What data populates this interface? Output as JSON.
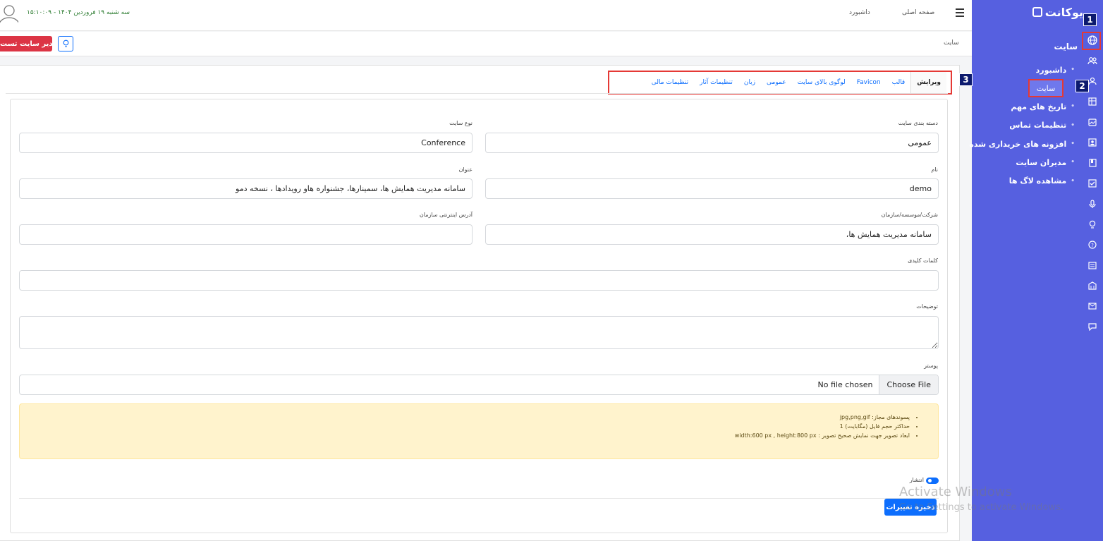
{
  "brand": {
    "name": "یوکانت"
  },
  "header": {
    "datetime": "سه شنبه ۱۹ فروردین ۱۴۰۴ - ۱۵:۱۰:۰۹",
    "links": {
      "dashboard": "داشبورد",
      "home": "صفحه اصلی"
    }
  },
  "toolbar": {
    "admin_button": "مدیر سایت تست",
    "breadcrumb": "سایت"
  },
  "sidebar": {
    "section_title": "سایت",
    "items": [
      {
        "label": "داشبورد"
      },
      {
        "label": "سایت"
      },
      {
        "label": "تاریخ های مهم"
      },
      {
        "label": "تنظیمات تماس"
      },
      {
        "label": "افزونه های خریداری شده"
      },
      {
        "label": "مدیران سایت"
      },
      {
        "label": "مشاهده لاگ ها"
      }
    ]
  },
  "tabs": [
    "ویرایش",
    "قالب",
    "Favicon",
    "لوگوی بالای سایت",
    "عمومی",
    "زبان",
    "تنظیمات آثار",
    "تنظیمات مالی"
  ],
  "form": {
    "site_category": {
      "label": "دسته بندی سایت",
      "value": "عمومی"
    },
    "site_type": {
      "label": "نوع سایت",
      "value": "Conference"
    },
    "name": {
      "label": "نام",
      "value": "demo"
    },
    "title": {
      "label": "عنوان",
      "value": "سامانه مدیریت همایش ها، سمینارها، جشنواره هاو رویدادها ، نسخه دمو"
    },
    "company": {
      "label": "شرکت/موسسه/سازمان",
      "value": "سامانه مدیریت همایش ها،"
    },
    "website": {
      "label": "آدرس اینترنتی سازمان",
      "value": ""
    },
    "keywords": {
      "label": "کلمات کلیدی",
      "value": ""
    },
    "description": {
      "label": "توضیحات",
      "value": ""
    },
    "poster": {
      "label": "پوستر",
      "button": "Choose File",
      "status": "No file chosen"
    },
    "notice": [
      "پسوندهای مجاز: jpg,png,gif",
      "حداکثر حجم فایل (مگابایت) 1",
      "ابعاد تصویر جهت نمایش صحیح تصویر : width:600 px , height:800 px"
    ],
    "publish": {
      "label": "انتشار",
      "on": true
    },
    "save_button": "ذخیره تغییرات"
  },
  "watermark": {
    "line1": "Activate Windows",
    "line2": "Go to Settings to activate Windows."
  },
  "annotations": {
    "badge1": "1",
    "badge2": "2",
    "badge3": "3"
  },
  "colors": {
    "sidebar": "#5660e0",
    "primary": "#0d6efd",
    "danger": "#dc3545",
    "notice_bg": "#fff3cd",
    "highlight": "#e53935"
  },
  "icons": [
    "globe-icon",
    "users-icon",
    "users-icon",
    "grid-icon",
    "image-icon",
    "user-card-icon",
    "book-icon",
    "checkbox-icon",
    "mic-icon",
    "bulb-icon",
    "help-icon",
    "list-icon",
    "building-icon",
    "mail-icon",
    "chat-icon"
  ]
}
